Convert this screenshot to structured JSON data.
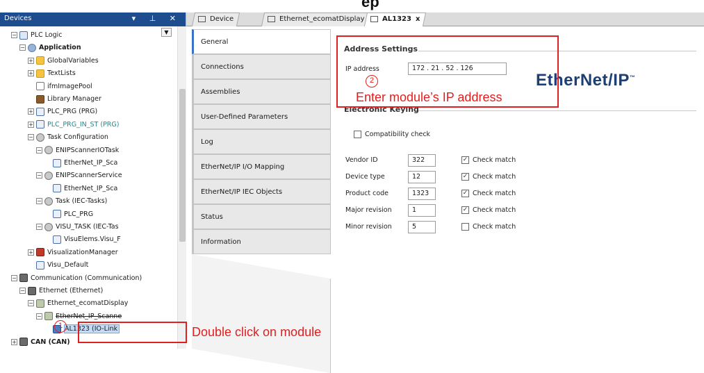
{
  "heading_fragment": "ep",
  "devices_panel": {
    "title": "Devices",
    "header_icons": "▾ ⊥ ✕",
    "tree": [
      {
        "label": "PLC Logic",
        "indent": 1,
        "icon": "plc-logic-icon",
        "exp": "minus"
      },
      {
        "label": "Application",
        "indent": 2,
        "icon": "application-gear-icon",
        "exp": "minus",
        "style": "bold"
      },
      {
        "label": "GlobalVariables",
        "indent": 3,
        "icon": "folder-icon",
        "exp": "plus"
      },
      {
        "label": "TextLists",
        "indent": 3,
        "icon": "folder-icon",
        "exp": "plus"
      },
      {
        "label": "ifmImagePool",
        "indent": 3,
        "icon": "image-pool-icon",
        "exp": "none"
      },
      {
        "label": "Library Manager",
        "indent": 3,
        "icon": "library-icon",
        "exp": "none"
      },
      {
        "label": "PLC_PRG (PRG)",
        "indent": 3,
        "icon": "program-icon",
        "exp": "plus"
      },
      {
        "label": "PLC_PRG_IN_ST (PRG)",
        "indent": 3,
        "icon": "program-icon",
        "exp": "plus",
        "style": "teal"
      },
      {
        "label": "Task Configuration",
        "indent": 3,
        "icon": "task-config-icon",
        "exp": "minus"
      },
      {
        "label": "ENIPScannerIOTask",
        "indent": 4,
        "icon": "task-icon",
        "exp": "minus"
      },
      {
        "label": "EtherNet_IP_Sca",
        "indent": 5,
        "icon": "program-call-icon",
        "exp": "none"
      },
      {
        "label": "ENIPScannerService",
        "indent": 4,
        "icon": "task-icon",
        "exp": "minus"
      },
      {
        "label": "EtherNet_IP_Sca",
        "indent": 5,
        "icon": "program-call-icon",
        "exp": "none"
      },
      {
        "label": "Task (IEC-Tasks)",
        "indent": 4,
        "icon": "task-icon",
        "exp": "minus"
      },
      {
        "label": "PLC_PRG",
        "indent": 5,
        "icon": "program-call-icon",
        "exp": "none"
      },
      {
        "label": "VISU_TASK (IEC-Tas",
        "indent": 4,
        "icon": "task-icon",
        "exp": "minus"
      },
      {
        "label": "VisuElems.Visu_F",
        "indent": 5,
        "icon": "program-call-icon",
        "exp": "none"
      },
      {
        "label": "VisualizationManager",
        "indent": 3,
        "icon": "visu-manager-icon",
        "exp": "plus"
      },
      {
        "label": "Visu_Default",
        "indent": 3,
        "icon": "visu-icon",
        "exp": "none"
      },
      {
        "label": "Communication (Communication)",
        "indent": 1,
        "icon": "communication-icon",
        "exp": "minus"
      },
      {
        "label": "Ethernet (Ethernet)",
        "indent": 2,
        "icon": "ethernet-icon",
        "exp": "minus"
      },
      {
        "label": "Ethernet_ecomatDisplay",
        "indent": 3,
        "icon": "ecomat-display-icon",
        "exp": "minus"
      },
      {
        "label": "EtherNet_IP_Scanne",
        "indent": 4,
        "icon": "scanner-icon",
        "exp": "minus",
        "style": "strike"
      },
      {
        "label": "AL1323 (IO-Link",
        "indent": 5,
        "icon": "module-icon",
        "exp": "none",
        "style": "selected"
      },
      {
        "label": "CAN (CAN)",
        "indent": 1,
        "icon": "can-icon",
        "exp": "plus",
        "style": "bold"
      }
    ]
  },
  "tabs": [
    {
      "label": "Device",
      "icon": "device-tab-icon"
    },
    {
      "label": "Ethernet_ecomatDisplay",
      "icon": "ecomat-tab-icon"
    },
    {
      "label": "AL1323",
      "icon": "module-tab-icon",
      "close": "x",
      "active": true
    }
  ],
  "side_tabs": [
    {
      "label": "General",
      "active": true
    },
    {
      "label": "Connections"
    },
    {
      "label": "Assemblies"
    },
    {
      "label": "User-Defined Parameters"
    },
    {
      "label": "Log"
    },
    {
      "label": "EtherNet/IP I/O Mapping"
    },
    {
      "label": "EtherNet/IP IEC Objects"
    },
    {
      "label": "Status"
    },
    {
      "label": "Information"
    }
  ],
  "general": {
    "address_settings_title": "Address Settings",
    "ip_label": "IP address",
    "ip_value": "172 . 21 . 52 . 126",
    "logo_text": "EtherNet/IP",
    "logo_tm": "™",
    "electronic_keying_title": "Electronic Keying",
    "compat_label": "Compatibility check",
    "compat_checked": false,
    "keying_rows": [
      {
        "label": "Vendor ID",
        "value": "322",
        "check_label": "Check match",
        "checked": true
      },
      {
        "label": "Device type",
        "value": "12",
        "check_label": "Check match",
        "checked": true
      },
      {
        "label": "Product code",
        "value": "1323",
        "check_label": "Check match",
        "checked": true
      },
      {
        "label": "Major revision",
        "value": "1",
        "check_label": "Check match",
        "checked": true
      },
      {
        "label": "Minor revision",
        "value": "5",
        "check_label": "Check match",
        "checked": false
      }
    ]
  },
  "annotations": {
    "step1_number": "1",
    "step1_text": "Double click on module",
    "step2_number": "2",
    "step2_text": "Enter module’s IP address",
    "color": "#e02020"
  }
}
